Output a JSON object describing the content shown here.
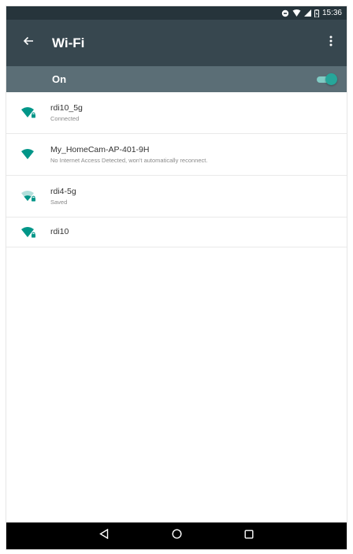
{
  "status_bar": {
    "time": "15:36",
    "icons": [
      "sync-icon",
      "wifi-signal-icon",
      "cell-signal-icon",
      "battery-icon"
    ]
  },
  "app_bar": {
    "title": "Wi-Fi",
    "back_icon": "arrow-back-icon",
    "menu_icon": "more-vert-icon"
  },
  "wifi_switch": {
    "label": "On",
    "state": "on"
  },
  "networks": [
    {
      "name": "rdi10_5g",
      "status": "Connected",
      "icon": "wifi-full-icon",
      "locked": true
    },
    {
      "name": "My_HomeCam-AP-401-9H",
      "status": "No Internet Access Detected, won't automatically reconnect.",
      "icon": "wifi-full-icon",
      "locked": false
    },
    {
      "name": "rdi4-5g",
      "status": "Saved",
      "icon": "wifi-weak-icon",
      "locked": true
    },
    {
      "name": "rdi10",
      "status": "",
      "icon": "wifi-full-icon",
      "locked": true
    }
  ],
  "nav_bar": {
    "buttons": [
      "back-icon",
      "home-icon",
      "recents-icon"
    ]
  },
  "colors": {
    "status_bar": "#26343b",
    "app_bar": "#37474f",
    "switch_bar": "#5b6e76",
    "accent": "#009688"
  }
}
